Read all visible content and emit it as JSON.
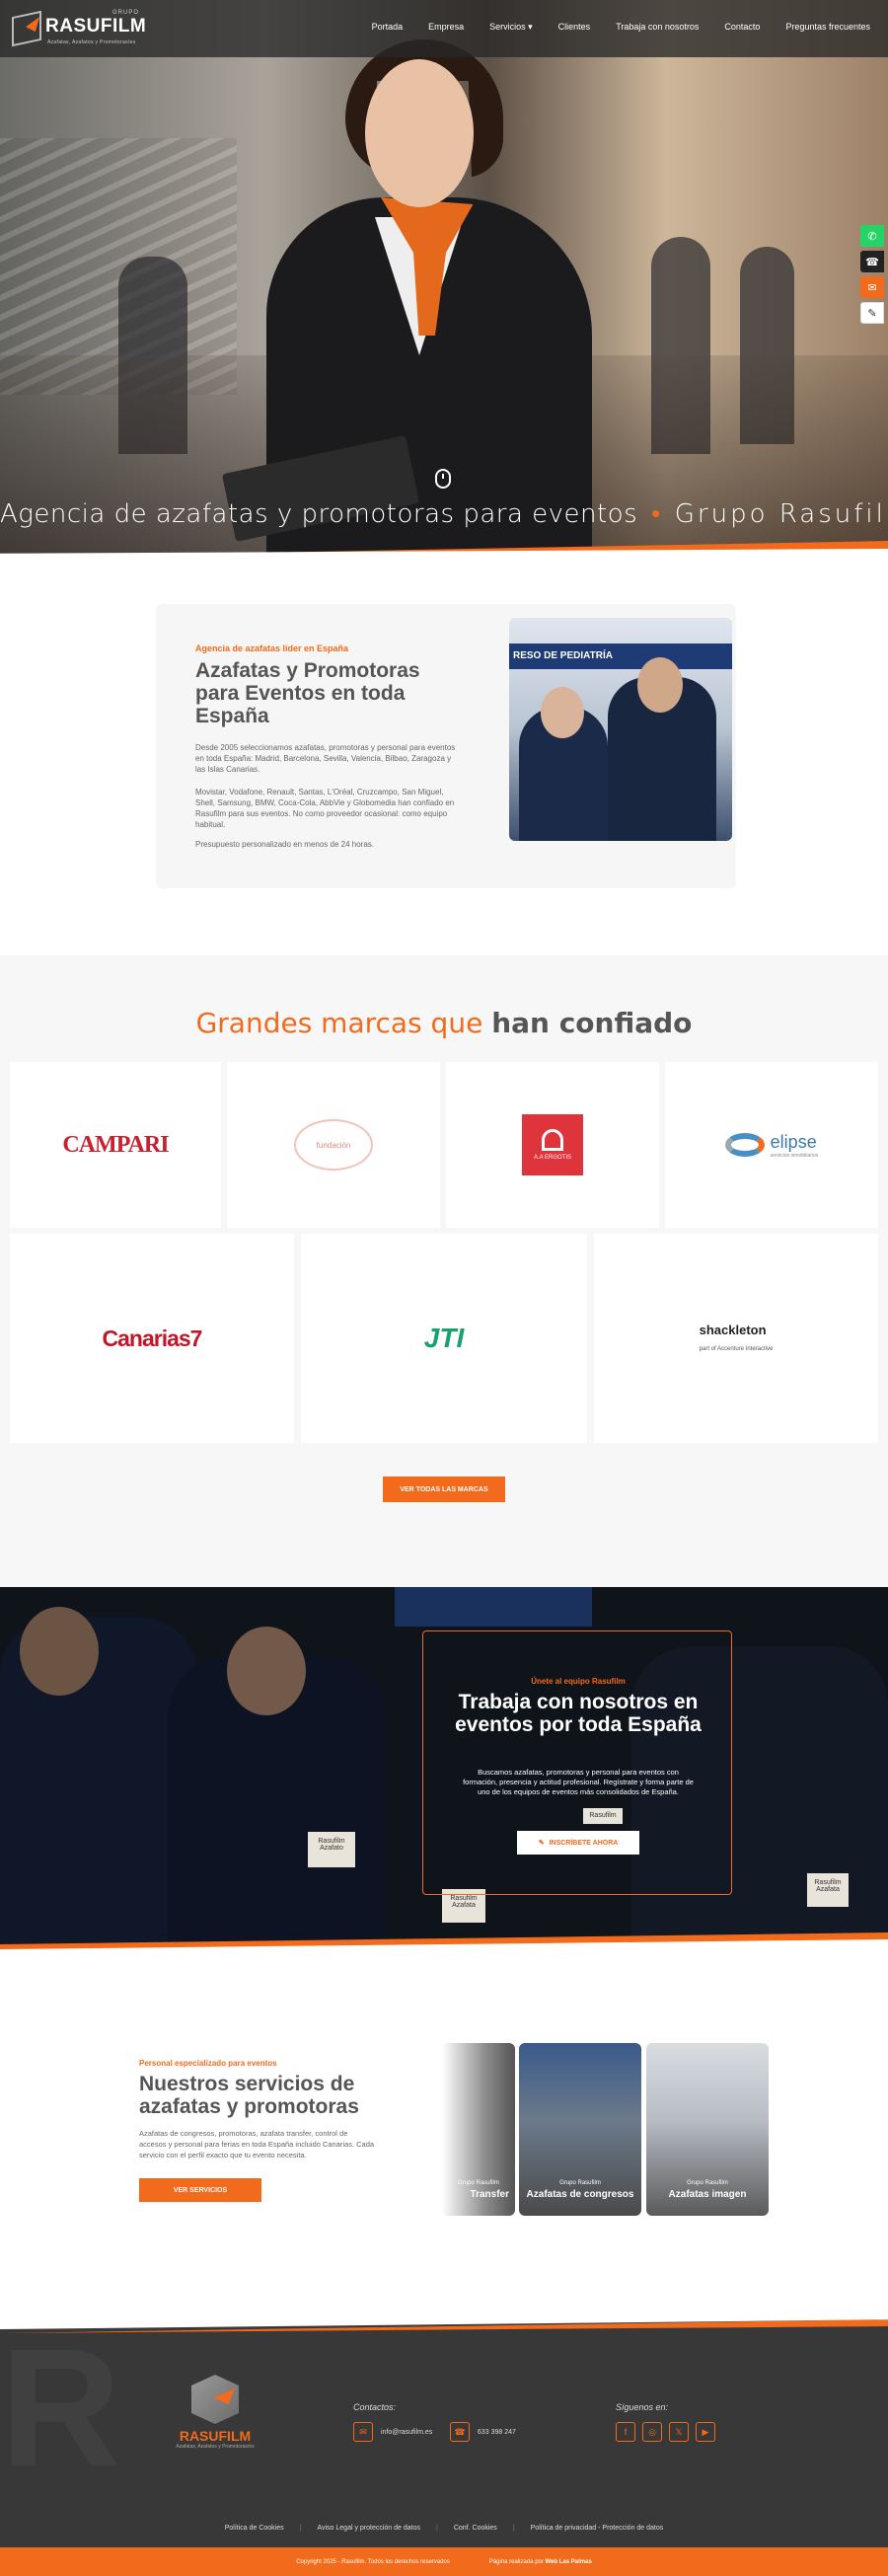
{
  "header": {
    "logo_sup": "GRUPO",
    "logo_name": "RASUFILM",
    "logo_tag": "Azafatas, Azafatos y Promotoras/es",
    "nav": [
      "Portada",
      "Empresa",
      "Servicios",
      "Clientes",
      "Trabaja con nosotros",
      "Contacto",
      "Preguntas frecuentes"
    ]
  },
  "hero": {
    "marquee": [
      "Agencia de azafatas y promotoras para eventos",
      "Grupo Rasufilm"
    ],
    "separator": "•"
  },
  "side_icons": [
    {
      "name": "whatsapp-icon",
      "glyph": "✆",
      "color": "#25d366"
    },
    {
      "name": "phone-icon",
      "glyph": "☎",
      "color": "#222222"
    },
    {
      "name": "email-icon",
      "glyph": "✉",
      "color": "#f26a1b"
    },
    {
      "name": "form-icon",
      "glyph": "✎",
      "color": "#ffffff"
    }
  ],
  "intro": {
    "kicker": "Agencia de azafatas líder en España",
    "title": "Azafatas y Promotoras para Eventos en toda España",
    "p1": "Desde 2005 seleccionamos azafatas, promotoras y personal para eventos en toda España: Madrid, Barcelona, Sevilla, Valencia, Bilbao, Zaragoza y las Islas Canarias.",
    "p2": "Movistar, Vodafone, Renault, Santas, L'Oréal, Cruzcampo, San Miguel, Shell, Samsung, BMW, Coca-Cola, AbbVie y Globomedia han confiado en Rasufilm para sus eventos. No como proveedor ocasional: como equipo habitual.",
    "p3": "Presupuesto personalizado en menos de 24 horas.",
    "image_banner": "RESO DE PEDIATRÍA"
  },
  "brands": {
    "title_light": "Grandes marcas que",
    "title_bold": "han confiado",
    "row1": [
      "CAMPARI",
      "fundación",
      "A.A ERGOTIS",
      "elipse"
    ],
    "row2": [
      "Canarias7",
      "JTI",
      "shackleton"
    ],
    "elipse_sub": "servicios inmobiliarios",
    "shackleton_sub": "part of Accenture Interactive",
    "button": "VER TODAS LAS MARCAS"
  },
  "trabaja": {
    "kicker": "Únete al equipo Rasufilm",
    "title": "Trabaja con nosotros en eventos por toda España",
    "text": "Buscamos azafatas, promotoras y personal para eventos con formación, presencia y actitud profesional. Regístrate y forma parte de uno de los equipos de eventos más consolidados de España.",
    "button": "INSCRÍBETE AHORA",
    "badges": [
      "Rasufilm Azafato",
      "Rasufilm Azafata",
      "Rasufilm",
      "Rasufilm Azafata"
    ]
  },
  "servicios": {
    "kicker": "Personal especializado para eventos",
    "title": "Nuestros servicios de azafatas y promotoras",
    "text": "Azafatas de congresos, promotoras, azafata transfer, control de accesos y personal para ferias en toda España incluido Canarias. Cada servicio con el perfil exacto que tu evento necesita.",
    "button": "VER SERVICIOS",
    "cards": [
      {
        "small": "Grupo Rasufilm",
        "title": "Transfer"
      },
      {
        "small": "Grupo Rasufilm",
        "title": "Azafatas de congresos"
      },
      {
        "small": "Grupo Rasufilm",
        "title": "Azafatas imagen"
      }
    ]
  },
  "footer": {
    "logo_name": "RASUFILM",
    "logo_tag": "Azafatas, Azafatos y Promotoras/es",
    "contact_title": "Contactos:",
    "email": "info@rasufilm.es",
    "phone": "633 398 247",
    "follow_title": "Síguenos en:",
    "social": [
      "f",
      "◎",
      "𝕏",
      "▶"
    ],
    "links": [
      "Política de Cookies",
      "Aviso Legal y protección de datos",
      "Conf. Cookies",
      "Política de privacidad - Protección de datos"
    ],
    "copyright": "Copyright 2025 - Rasufilm. Todos los derechos reservados",
    "credit_prefix": "Página realizada por",
    "credit_name": "Web Las Palmas"
  },
  "colors": {
    "accent": "#f26a1b",
    "dark": "#383838"
  }
}
